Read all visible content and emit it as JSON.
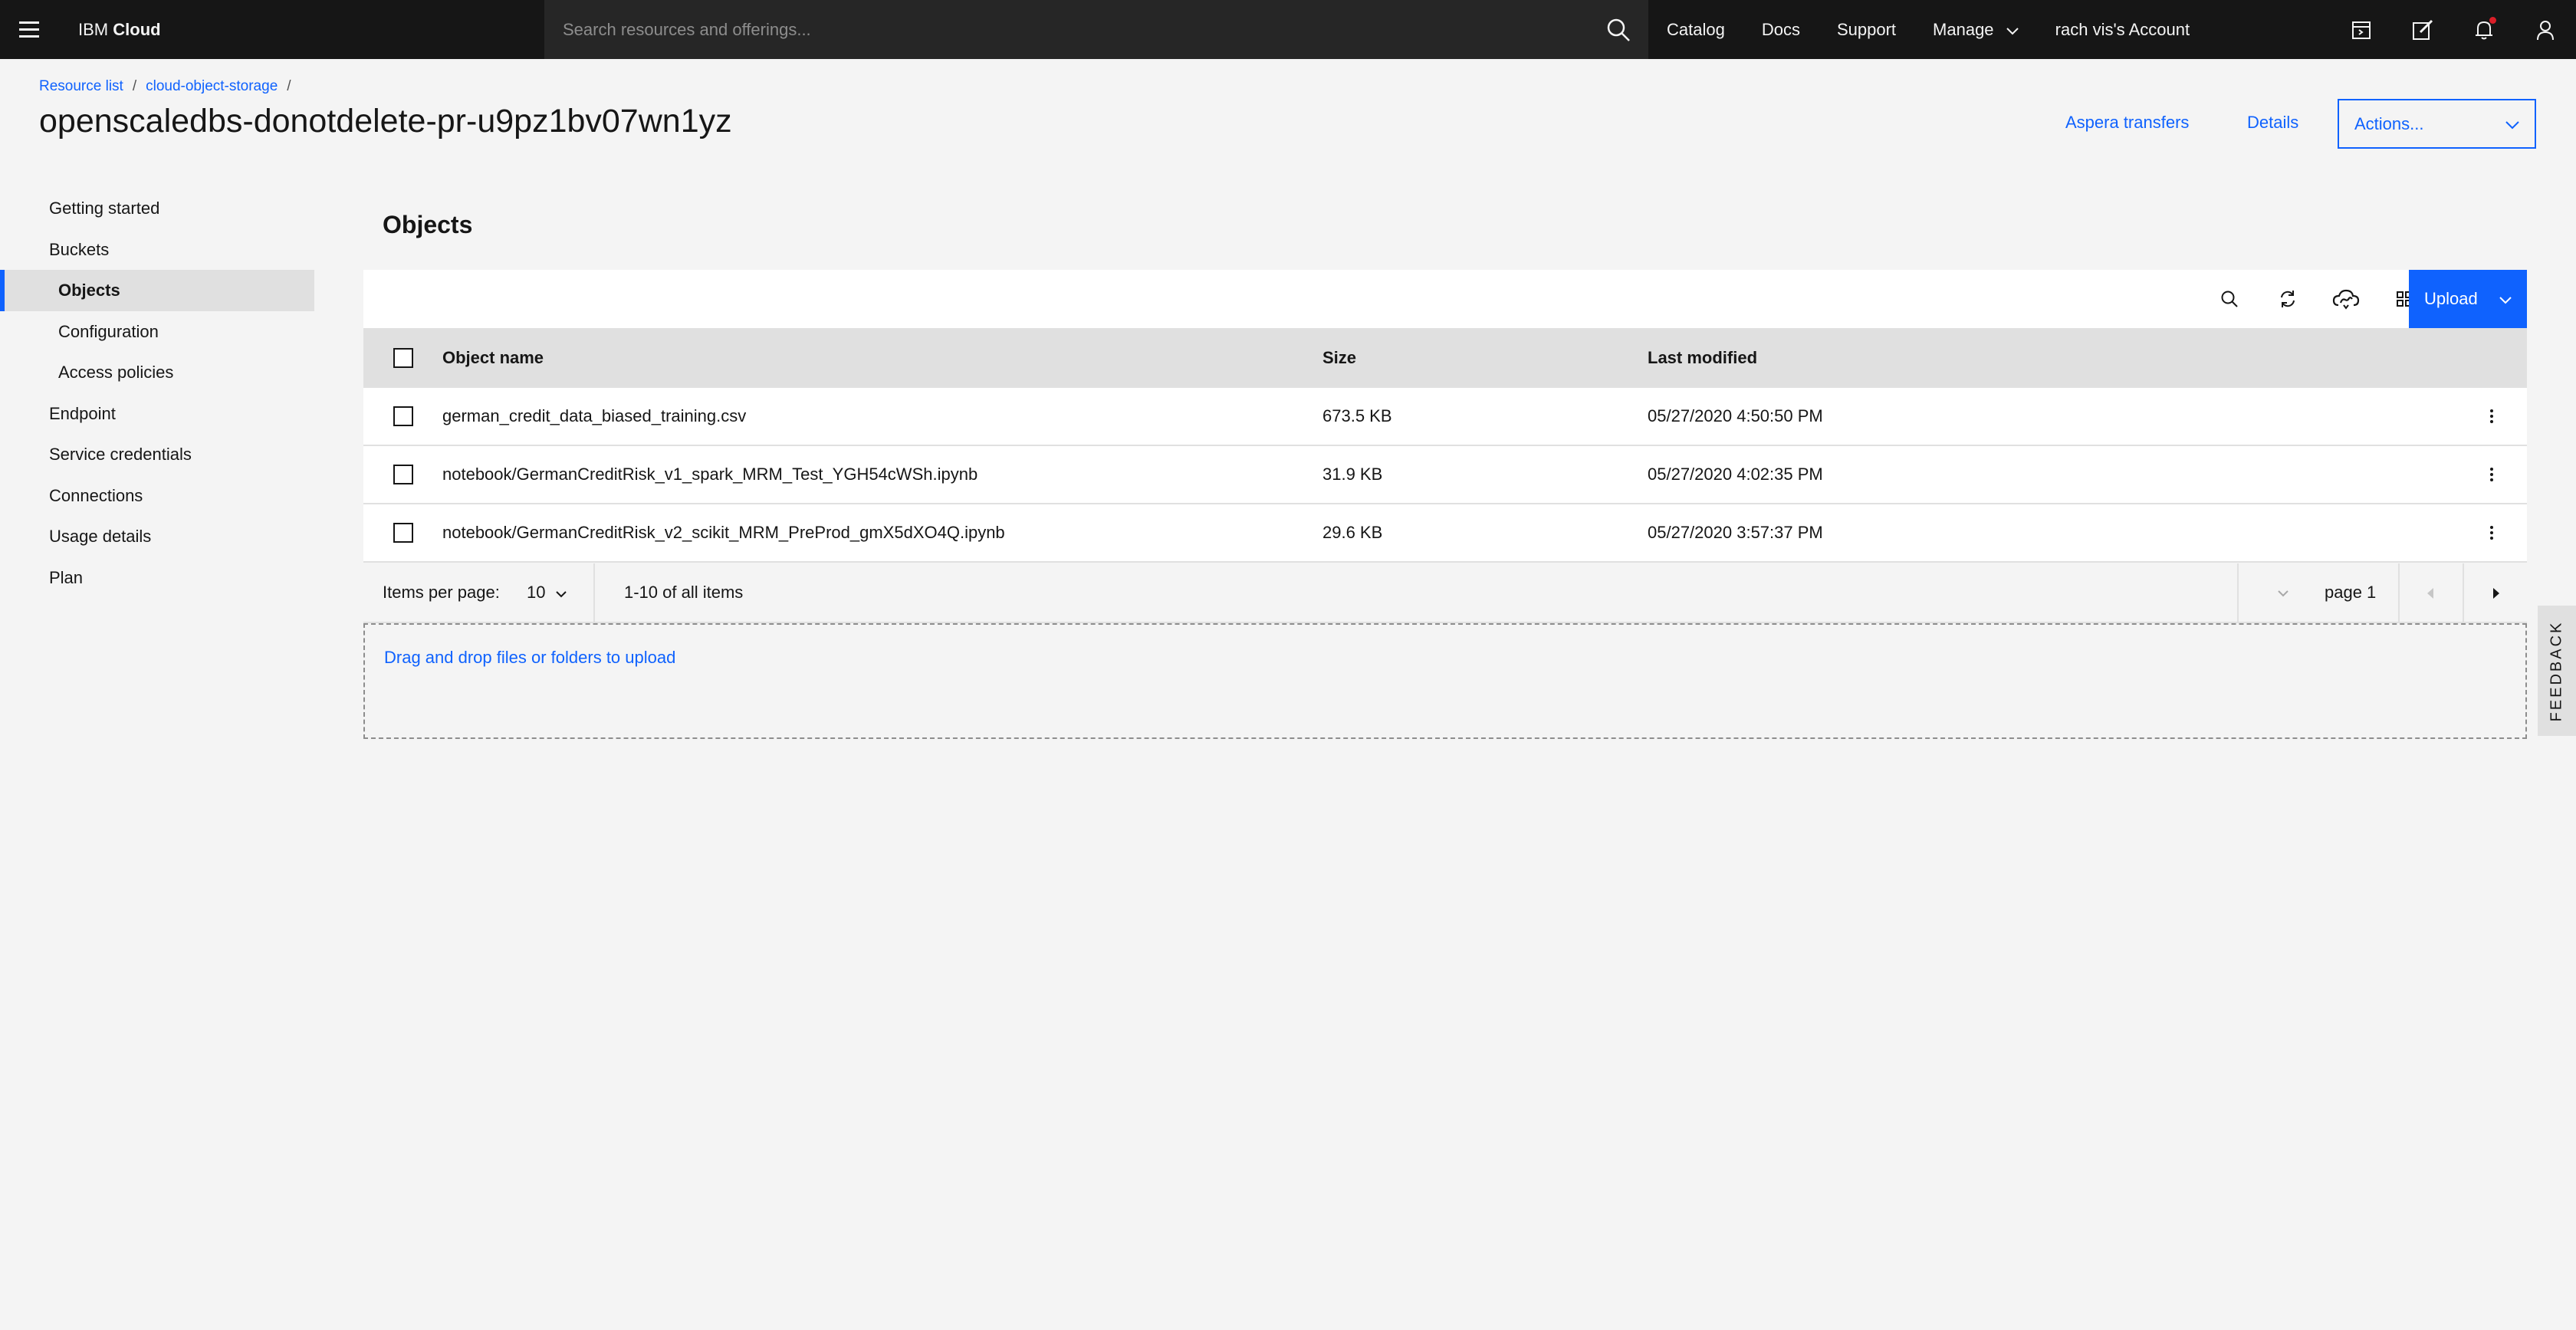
{
  "topbar": {
    "brand_prefix": "IBM",
    "brand_suffix": "Cloud",
    "search_placeholder": "Search resources and offerings...",
    "nav": [
      "Catalog",
      "Docs",
      "Support",
      "Manage",
      "rach vis's Account"
    ]
  },
  "breadcrumb": {
    "items": [
      "Resource list",
      "cloud-object-storage"
    ],
    "separator": "/"
  },
  "page": {
    "title": "openscaledbs-donotdelete-pr-u9pz1bv07wn1yz",
    "aspera_label": "Aspera transfers",
    "details_label": "Details",
    "actions_label": "Actions..."
  },
  "sidebar": {
    "items": [
      {
        "label": "Getting started"
      },
      {
        "label": "Buckets"
      },
      {
        "label": "Objects"
      },
      {
        "label": "Configuration"
      },
      {
        "label": "Access policies"
      },
      {
        "label": "Endpoint"
      },
      {
        "label": "Service credentials"
      },
      {
        "label": "Connections"
      },
      {
        "label": "Usage details"
      },
      {
        "label": "Plan"
      }
    ]
  },
  "main": {
    "section_title": "Objects",
    "upload_label": "Upload",
    "columns": {
      "name": "Object name",
      "size": "Size",
      "modified": "Last modified"
    },
    "rows": [
      {
        "name": "german_credit_data_biased_training.csv",
        "size": "673.5 KB",
        "modified": "05/27/2020 4:50:50 PM"
      },
      {
        "name": "notebook/GermanCreditRisk_v1_spark_MRM_Test_YGH54cWSh.ipynb",
        "size": "31.9 KB",
        "modified": "05/27/2020 4:02:35 PM"
      },
      {
        "name": "notebook/GermanCreditRisk_v2_scikit_MRM_PreProd_gmX5dXO4Q.ipynb",
        "size": "29.6 KB",
        "modified": "05/27/2020 3:57:37 PM"
      }
    ],
    "pagination": {
      "items_per_page_label": "Items per page:",
      "items_per_page_value": "10",
      "range": "1-10 of all items",
      "page": "page 1"
    },
    "dropzone_label": "Drag and drop files or folders to upload"
  },
  "feedback_label": "FEEDBACK",
  "colors": {
    "accent": "#0f62fe",
    "topbar": "#161616",
    "background": "#f4f4f4",
    "notification": "#da1e28"
  },
  "icons": [
    "menu-icon",
    "search-icon",
    "calendar-icon",
    "edit-icon",
    "bell-icon",
    "user-icon",
    "refresh-icon",
    "cloud-aspera-icon",
    "grid-view-icon",
    "overflow-menu-icon",
    "chevron-down-icon",
    "caret-left-icon",
    "caret-right-icon"
  ]
}
